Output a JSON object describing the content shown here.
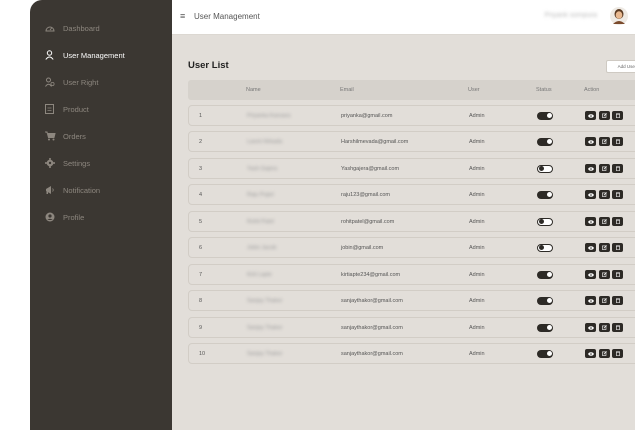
{
  "sidebar": {
    "items": [
      {
        "label": "Dashboard",
        "icon": "dashboard-icon",
        "active": false
      },
      {
        "label": "User Management",
        "icon": "user-icon",
        "active": true
      },
      {
        "label": "User Right",
        "icon": "user-right-icon",
        "active": false
      },
      {
        "label": "Product",
        "icon": "product-icon",
        "active": false
      },
      {
        "label": "Orders",
        "icon": "cart-icon",
        "active": false
      },
      {
        "label": "Settings",
        "icon": "gear-icon",
        "active": false
      },
      {
        "label": "Notification",
        "icon": "megaphone-icon",
        "active": false
      },
      {
        "label": "Profile",
        "icon": "profile-icon",
        "active": false
      }
    ]
  },
  "header": {
    "title": "User Management",
    "menu_glyph": "≡",
    "user_name": "Priyank sompura"
  },
  "page": {
    "title": "User List",
    "add_button": "Add User"
  },
  "table": {
    "headers": [
      "Name",
      "Email",
      "User",
      "Status",
      "Action"
    ],
    "rows": [
      {
        "no": "1",
        "name": "Priyanka Kansara",
        "email": "priyanka@gmail.com",
        "user": "Admin",
        "status": "on"
      },
      {
        "no": "2",
        "name": "Laxmi Hirkada",
        "email": "Harshilmevada@gmail.com",
        "user": "Admin",
        "status": "on"
      },
      {
        "no": "3",
        "name": "Yash Gajera",
        "email": "Yashgajera@gmail.com",
        "user": "Admin",
        "status": "off"
      },
      {
        "no": "4",
        "name": "Raju Pujari",
        "email": "raju123@gmail.com",
        "user": "Admin",
        "status": "on"
      },
      {
        "no": "5",
        "name": "Rohit Patel",
        "email": "rohitpatel@gmail.com",
        "user": "Admin",
        "status": "off"
      },
      {
        "no": "6",
        "name": "Jobin Jacob",
        "email": "jobin@gmail.com",
        "user": "Admin",
        "status": "off"
      },
      {
        "no": "7",
        "name": "Kirti Lapte",
        "email": "kirtiapte234@gmail.com",
        "user": "Admin",
        "status": "on"
      },
      {
        "no": "8",
        "name": "Sanjay Thakor",
        "email": "sanjaythakor@gmail.com",
        "user": "Admin",
        "status": "on"
      },
      {
        "no": "9",
        "name": "Sanjay Thakor",
        "email": "sanjaythakor@gmail.com",
        "user": "Admin",
        "status": "on"
      },
      {
        "no": "10",
        "name": "Sanjay Thakor",
        "email": "sanjaythakor@gmail.com",
        "user": "Admin",
        "status": "on"
      }
    ],
    "actions": [
      "view-icon",
      "edit-icon",
      "delete-icon"
    ]
  },
  "colors": {
    "sidebar_bg": "#3b3732",
    "main_bg": "#e2ded9",
    "accent_dark": "#2d2a26"
  }
}
